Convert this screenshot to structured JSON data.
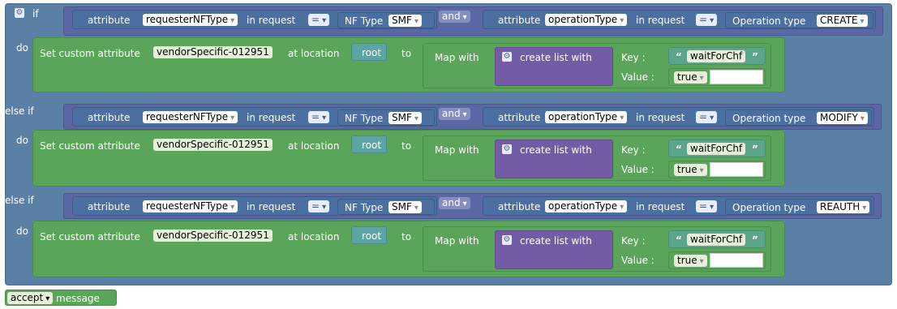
{
  "if_label": "if",
  "elseif_label": "else if",
  "do_label": "do",
  "condition_texts": {
    "attribute": "attribute",
    "in_request": "in request",
    "nf_type": "NF Type",
    "and": "and",
    "operation_type": "Operation type"
  },
  "fields": {
    "requesterNFType": "requesterNFType",
    "operationType": "operationType",
    "eq": "=",
    "smf": "SMF"
  },
  "branches": [
    {
      "operation": "CREATE"
    },
    {
      "operation": "MODIFY"
    },
    {
      "operation": "REAUTH"
    }
  ],
  "action": {
    "set_custom_attribute": "Set custom attribute",
    "attribute_name": "vendorSpecific-012951",
    "at_location": "at location",
    "location": "root",
    "to": "to",
    "map_with": "Map with",
    "create_list_with": "create list with",
    "key_label": "Key :",
    "value_label": "Value :",
    "key_value": "waitForChf",
    "bool_value": "true",
    "open_quote": "“",
    "close_quote": "”"
  },
  "footer": {
    "accept": "accept",
    "message": "message"
  },
  "colors": {
    "if_block": "#5b80a5",
    "do_block": "#5ba55b",
    "list_block": "#745ba5",
    "string_block": "#5ba58c"
  }
}
